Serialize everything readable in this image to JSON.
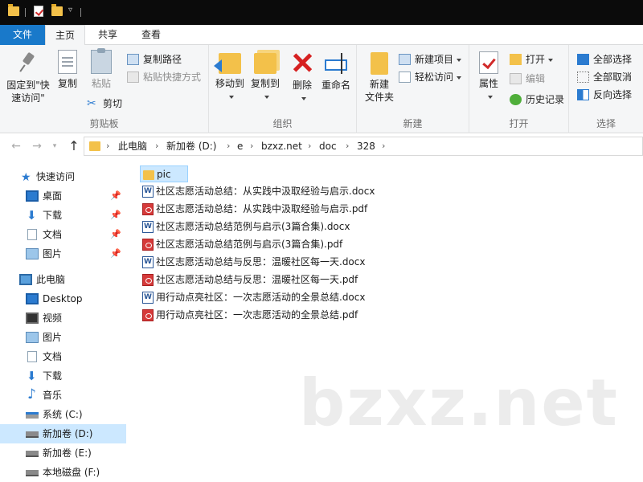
{
  "ribbon_tabs": {
    "file": "文件",
    "home": "主页",
    "share": "共享",
    "view": "查看"
  },
  "clipboard": {
    "pin_quick_access": "固定到\"快",
    "pin_quick_access_2": "速访问\"",
    "copy": "复制",
    "paste": "粘贴",
    "copy_path": "复制路径",
    "paste_shortcut": "粘贴快捷方式",
    "cut": "剪切",
    "group_label": "剪贴板"
  },
  "organize": {
    "move_to": "移动到",
    "copy_to": "复制到",
    "delete": "删除",
    "rename": "重命名",
    "group_label": "组织"
  },
  "new_group": {
    "new_folder": "新建",
    "new_folder_2": "文件夹",
    "new_item": "新建项目",
    "easy_access": "轻松访问",
    "group_label": "新建"
  },
  "open_group": {
    "properties": "属性",
    "open": "打开",
    "edit": "编辑",
    "history": "历史记录",
    "group_label": "打开"
  },
  "select_group": {
    "select_all": "全部选择",
    "select_none": "全部取消",
    "invert": "反向选择",
    "group_label": "选择"
  },
  "address": {
    "crumbs": [
      "此电脑",
      "新加卷 (D:)",
      "e",
      "bzxz.net",
      "doc",
      "328"
    ]
  },
  "nav_pane": {
    "quick_access": "快速访问",
    "qa_items": [
      "桌面",
      "下载",
      "文档",
      "图片"
    ],
    "this_pc": "此电脑",
    "pc_items": [
      "Desktop",
      "视频",
      "图片",
      "文档",
      "下载",
      "音乐",
      "系统 (C:)",
      "新加卷 (D:)",
      "新加卷 (E:)",
      "本地磁盘 (F:)"
    ]
  },
  "files": [
    {
      "name": "pic",
      "type": "folder"
    },
    {
      "name": "社区志愿活动总结：从实践中汲取经验与启示.docx",
      "type": "docx"
    },
    {
      "name": "社区志愿活动总结：从实践中汲取经验与启示.pdf",
      "type": "pdf"
    },
    {
      "name": "社区志愿活动总结范例与启示(3篇合集).docx",
      "type": "docx"
    },
    {
      "name": "社区志愿活动总结范例与启示(3篇合集).pdf",
      "type": "pdf"
    },
    {
      "name": "社区志愿活动总结与反思：温暖社区每一天.docx",
      "type": "docx"
    },
    {
      "name": "社区志愿活动总结与反思：温暖社区每一天.pdf",
      "type": "pdf"
    },
    {
      "name": "用行动点亮社区：一次志愿活动的全景总结.docx",
      "type": "docx"
    },
    {
      "name": "用行动点亮社区：一次志愿活动的全景总结.pdf",
      "type": "pdf"
    }
  ],
  "watermark": "bzxz.net",
  "colors": {
    "accent": "#1979ca",
    "selection": "#cce8ff",
    "folder": "#f3c14a",
    "pdf": "#d63a3a",
    "docx": "#2b5797"
  }
}
